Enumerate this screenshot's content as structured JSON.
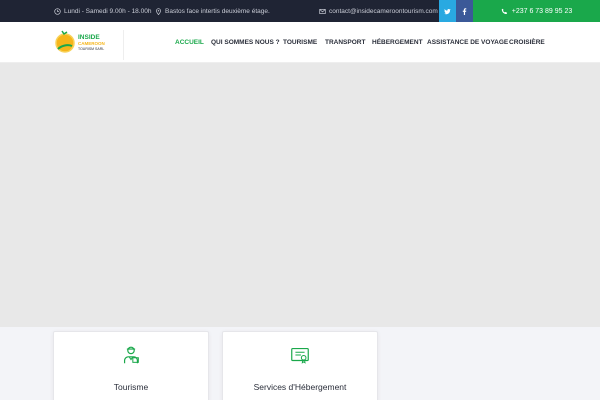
{
  "topbar": {
    "hours": "Lundi - Samedi 9.00h - 18.00h",
    "address": "Bastos face intertis deuxième étage.",
    "email": "contact@insidecameroontourism.com",
    "phone": "+237 6 73 89 95 23",
    "social": {
      "twitter_icon": "twitter-icon",
      "facebook_icon": "facebook-icon"
    }
  },
  "logo": {
    "line1": "INSIDE",
    "line2": "CAMEROON",
    "line3": "TOURISM SARL"
  },
  "nav": {
    "items": [
      "ACCUEIL",
      "QUI SOMMES NOUS ?",
      "TOURISME",
      "TRANSPORT",
      "HÉBERGEMENT",
      "ASSISTANCE DE VOYAGE",
      "CROISIÈRE"
    ]
  },
  "cards": [
    {
      "title": "Tourisme",
      "icon": "tour-guide-icon"
    },
    {
      "title": "Services d'Hébergement",
      "icon": "certificate-icon"
    }
  ],
  "colors": {
    "topbar_bg": "#1f2434",
    "accent_green": "#1aa84b",
    "twitter": "#29a9e1",
    "facebook": "#3b5998",
    "hero_bg": "#e8e8e8"
  }
}
